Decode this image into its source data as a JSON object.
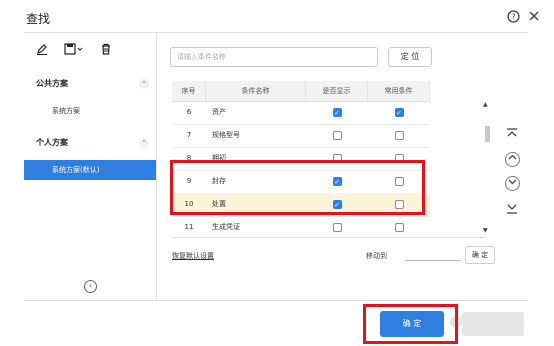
{
  "dialog": {
    "title": "查找",
    "help_icon": "help-circle-icon",
    "close_icon": "close-icon"
  },
  "sidebar": {
    "toolbar_icons": [
      "edit-icon",
      "save-icon",
      "delete-icon"
    ],
    "groups": [
      {
        "title": "公共方案",
        "items": [
          {
            "label": "系统方案",
            "selected": false
          }
        ]
      },
      {
        "title": "个人方案",
        "items": [
          {
            "label": "系统方案(默认)",
            "selected": true
          }
        ]
      }
    ],
    "collapse_icon": "collapse-left-icon"
  },
  "search": {
    "placeholder": "请输入条件名称",
    "locate_label": "定 位"
  },
  "table": {
    "headers": [
      "序号",
      "条件名称",
      "是否显示",
      "常用条件"
    ],
    "rows": [
      {
        "no": "6",
        "name": "资产",
        "show": true,
        "common": true
      },
      {
        "no": "7",
        "name": "规格型号",
        "show": false,
        "common": false
      },
      {
        "no": "8",
        "name": "期初",
        "show": false,
        "common": false
      },
      {
        "no": "9",
        "name": "封存",
        "show": true,
        "common": false
      },
      {
        "no": "10",
        "name": "处置",
        "show": true,
        "common": false
      },
      {
        "no": "11",
        "name": "生成凭证",
        "show": false,
        "common": false
      }
    ],
    "highlighted_row": "10",
    "scroll_position": 0.15
  },
  "nav_icons": [
    "move-top-icon",
    "move-up-icon",
    "move-down-icon",
    "move-bottom-icon"
  ],
  "footer": {
    "restore_label": "恢复默认设置",
    "move_to_label": "移动到",
    "move_confirm_label": "确 定",
    "ok_label": "确 定"
  },
  "colors": {
    "accent": "#2f7fe0",
    "highlight": "#fdf3d8",
    "annotation_red": "#e0141a"
  }
}
